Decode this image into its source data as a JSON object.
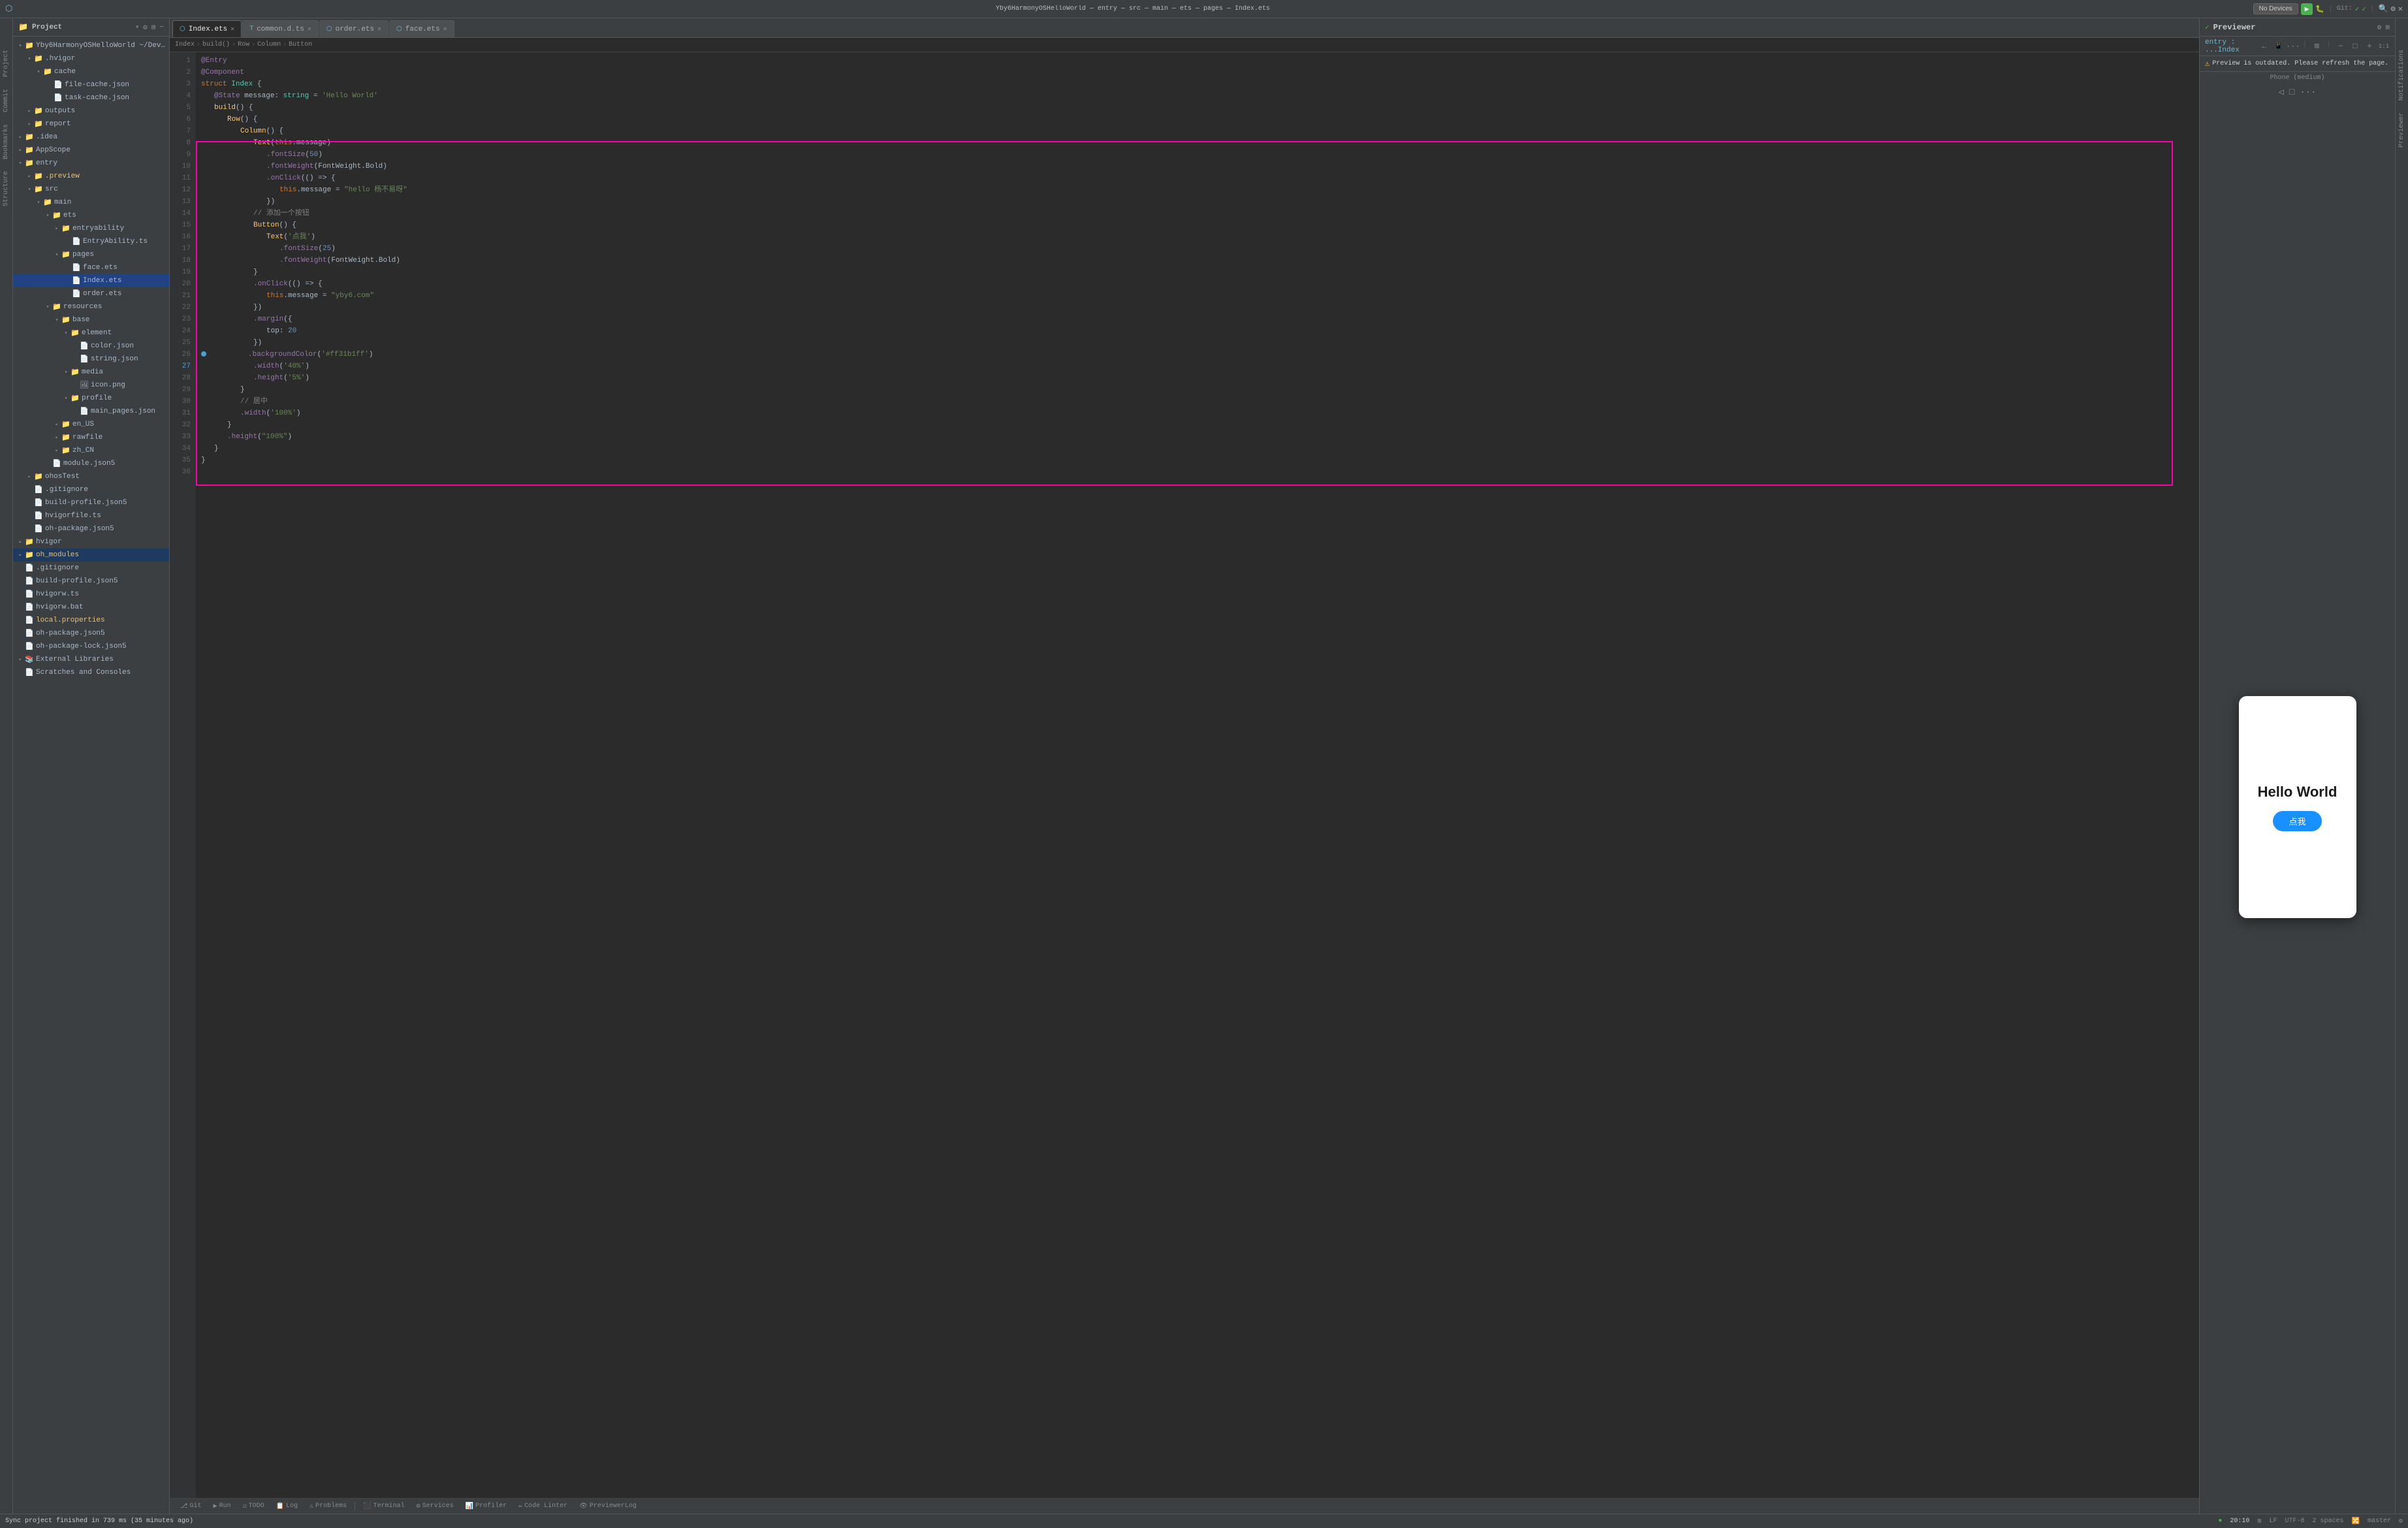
{
  "titlebar": {
    "title": "Yby6HarmonyOSHelloWorld — entry — src — main — ets — pages — Index.ets",
    "no_devices_label": "No Devices",
    "entry_label": "entry",
    "git_label": "Git:",
    "run_label": "▶",
    "branch_label": "master"
  },
  "project_panel": {
    "title": "Project",
    "root": "Yby6HarmonyOSHelloWorld ~/DevEcoStudio..."
  },
  "tabs": [
    {
      "label": "Index.ets",
      "active": true,
      "icon": "ets"
    },
    {
      "label": "common.d.ts",
      "active": false,
      "icon": "ts"
    },
    {
      "label": "order.ets",
      "active": false,
      "icon": "ets"
    },
    {
      "label": "face.ets",
      "active": false,
      "icon": "ets"
    }
  ],
  "breadcrumb": {
    "items": [
      "Index",
      "build()",
      "Row",
      "Column",
      "Button"
    ]
  },
  "code_lines": [
    {
      "num": 1,
      "content": "@Entry",
      "type": "decorator"
    },
    {
      "num": 2,
      "content": "@Component",
      "type": "decorator"
    },
    {
      "num": 3,
      "content": "struct Index {",
      "type": "normal"
    },
    {
      "num": 4,
      "content": "    @State message: string = 'Hello World'",
      "type": "normal"
    },
    {
      "num": 5,
      "content": "",
      "type": "normal"
    },
    {
      "num": 6,
      "content": "    build() {",
      "type": "normal"
    },
    {
      "num": 7,
      "content": "        Row() {",
      "type": "normal"
    },
    {
      "num": 8,
      "content": "            Column() {",
      "type": "normal"
    },
    {
      "num": 9,
      "content": "                Text(this.message)",
      "type": "normal"
    },
    {
      "num": 10,
      "content": "                    .fontSize(50)",
      "type": "normal"
    },
    {
      "num": 11,
      "content": "                    .fontWeight(FontWeight.Bold)",
      "type": "normal"
    },
    {
      "num": 12,
      "content": "                    .onClick(() => {",
      "type": "normal"
    },
    {
      "num": 13,
      "content": "                        this.message = \"hello 杨不易呀\"",
      "type": "normal"
    },
    {
      "num": 14,
      "content": "                    })",
      "type": "normal"
    },
    {
      "num": 15,
      "content": "                // 添加一个按钮",
      "type": "comment"
    },
    {
      "num": 16,
      "content": "                Button() {",
      "type": "normal"
    },
    {
      "num": 17,
      "content": "                    Text('点我')",
      "type": "normal"
    },
    {
      "num": 18,
      "content": "                        .fontSize(25)",
      "type": "normal"
    },
    {
      "num": 19,
      "content": "                        .fontWeight(FontWeight.Bold)",
      "type": "normal"
    },
    {
      "num": 20,
      "content": "                }",
      "type": "normal"
    },
    {
      "num": 21,
      "content": "                .onClick(() => {",
      "type": "normal"
    },
    {
      "num": 22,
      "content": "                    this.message = \"yby6.com\"",
      "type": "normal"
    },
    {
      "num": 23,
      "content": "                })",
      "type": "normal"
    },
    {
      "num": 24,
      "content": "                .margin({",
      "type": "normal"
    },
    {
      "num": 25,
      "content": "                    top: 20",
      "type": "normal"
    },
    {
      "num": 26,
      "content": "                })",
      "type": "normal"
    },
    {
      "num": 27,
      "content": "                .backgroundColor('#ff31b1ff')",
      "type": "special"
    },
    {
      "num": 28,
      "content": "                .width('40%')",
      "type": "normal"
    },
    {
      "num": 29,
      "content": "                .height('5%')",
      "type": "normal"
    },
    {
      "num": 30,
      "content": "            }",
      "type": "normal"
    },
    {
      "num": 31,
      "content": "            // 居中",
      "type": "comment"
    },
    {
      "num": 32,
      "content": "            .width('100%')",
      "type": "normal"
    },
    {
      "num": 33,
      "content": "        }",
      "type": "normal"
    },
    {
      "num": 34,
      "content": "        .height(\"100%\")",
      "type": "normal"
    },
    {
      "num": 35,
      "content": "    }",
      "type": "normal"
    },
    {
      "num": 36,
      "content": "}",
      "type": "normal"
    }
  ],
  "previewer": {
    "title": "Previewer",
    "entry_label": "entry : ...Index",
    "warning_text": "Preview is outdated. Please refresh the page.",
    "phone_label": "Phone (medium)",
    "hello_text": "Hello World",
    "button_text": "点我"
  },
  "status_bar": {
    "sync_text": "Sync project finished in 739 ms (35 minutes ago)",
    "time": "20:10",
    "encoding": "UTF-8",
    "line_sep": "LF",
    "indent": "2 spaces",
    "branch": "master",
    "git_icon": "Git"
  },
  "bottom_tabs": [
    {
      "label": "Git",
      "icon": "git"
    },
    {
      "label": "Run",
      "icon": "run"
    },
    {
      "label": "TODO",
      "icon": "todo"
    },
    {
      "label": "Log",
      "icon": "log"
    },
    {
      "label": "Problems",
      "icon": "problems"
    },
    {
      "label": "Terminal",
      "icon": "terminal"
    },
    {
      "label": "Services",
      "icon": "services"
    },
    {
      "label": "Profiler",
      "icon": "profiler"
    },
    {
      "label": "Code Linter",
      "icon": "linter"
    },
    {
      "label": "PreviewerLog",
      "icon": "preview-log"
    }
  ],
  "left_vert_tabs": [
    "Project",
    "Commit",
    "Bookmarks",
    "Structure"
  ],
  "right_vert_tabs": [
    "Notifications",
    "Previewer"
  ]
}
